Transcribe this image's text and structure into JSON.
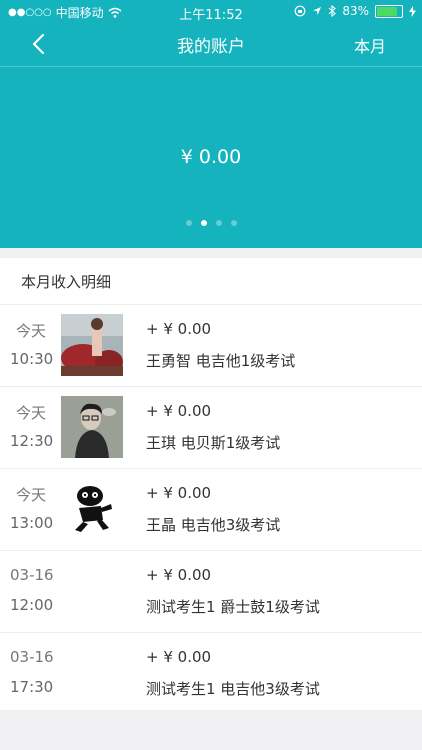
{
  "status_bar": {
    "carrier": "中国移动",
    "time": "上午11:52",
    "battery": "83%",
    "battery_level": 0.83,
    "signal_icon": "signal-dots-icon",
    "wifi_icon": "wifi-icon"
  },
  "nav": {
    "title": "我的账户",
    "right_label": "本月",
    "back_icon": "chevron-left-icon"
  },
  "balance": {
    "amount": "¥ 0.00"
  },
  "pager": {
    "count": 4,
    "active": 1
  },
  "section_title": "本月收入明细",
  "records": [
    {
      "day": "今天",
      "time": "10:30",
      "amount": "+ ¥ 0.00",
      "desc": "王勇智 电吉他1级考试"
    },
    {
      "day": "今天",
      "time": "12:30",
      "amount": "+ ¥ 0.00",
      "desc": "王琪 电贝斯1级考试"
    },
    {
      "day": "今天",
      "time": "13:00",
      "amount": "+ ¥ 0.00",
      "desc": "王晶 电吉他3级考试"
    },
    {
      "day": "03-16",
      "time": "12:00",
      "amount": "+ ¥ 0.00",
      "desc": "测试考生1 爵士鼓1级考试"
    },
    {
      "day": "03-16",
      "time": "17:30",
      "amount": "+ ¥ 0.00",
      "desc": "测试考生1 电吉他3级考试"
    }
  ],
  "colors": {
    "primary": "#14b3be",
    "battery": "#4cd964",
    "background": "#f0f0f2"
  }
}
